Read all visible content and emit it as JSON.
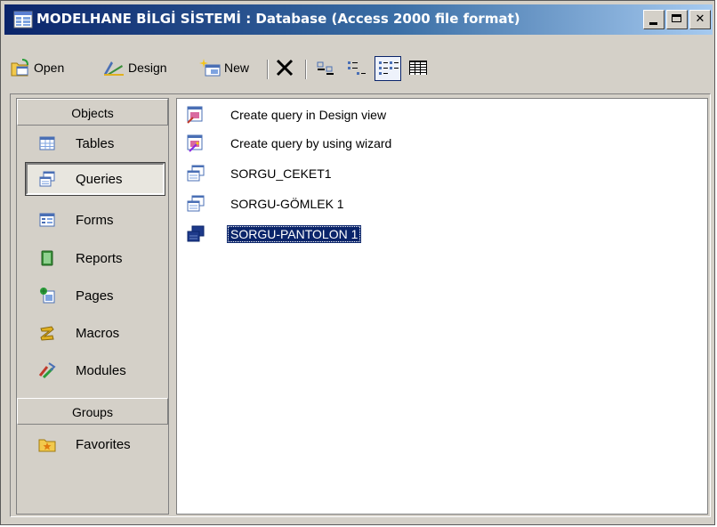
{
  "window": {
    "title": "MODELHANE BİLGİ SİSTEMİ : Database (Access 2000 file format)",
    "controls": {
      "minimize": "_",
      "maximize": "□",
      "close": "✕"
    }
  },
  "toolbar": {
    "open_label": "Open",
    "design_label": "Design",
    "new_label": "New"
  },
  "sidebar": {
    "objects_header": "Objects",
    "items": [
      {
        "label": "Tables",
        "icon": "table-icon"
      },
      {
        "label": "Queries",
        "icon": "query-icon"
      },
      {
        "label": "Forms",
        "icon": "form-icon"
      },
      {
        "label": "Reports",
        "icon": "report-icon"
      },
      {
        "label": "Pages",
        "icon": "page-icon"
      },
      {
        "label": "Macros",
        "icon": "macro-icon"
      },
      {
        "label": "Modules",
        "icon": "module-icon"
      }
    ],
    "selected": "Queries",
    "groups_header": "Groups",
    "groups": [
      {
        "label": "Favorites",
        "icon": "favorites-folder-icon"
      }
    ]
  },
  "list": {
    "items": [
      {
        "label": "Create query in Design view",
        "icon": "design-query-shortcut-icon"
      },
      {
        "label": "Create query by using wizard",
        "icon": "wizard-query-shortcut-icon"
      },
      {
        "label": "SORGU_CEKET1",
        "icon": "query-icon"
      },
      {
        "label": "SORGU-GÖMLEK 1",
        "icon": "query-icon"
      },
      {
        "label": "SORGU-PANTOLON 1",
        "icon": "query-icon"
      }
    ],
    "selected": "SORGU-PANTOLON 1"
  },
  "colors": {
    "title_gradient_start": "#0a246a",
    "title_gradient_end": "#a6caf0",
    "selection": "#0a246a",
    "chrome": "#d4d0c8"
  }
}
